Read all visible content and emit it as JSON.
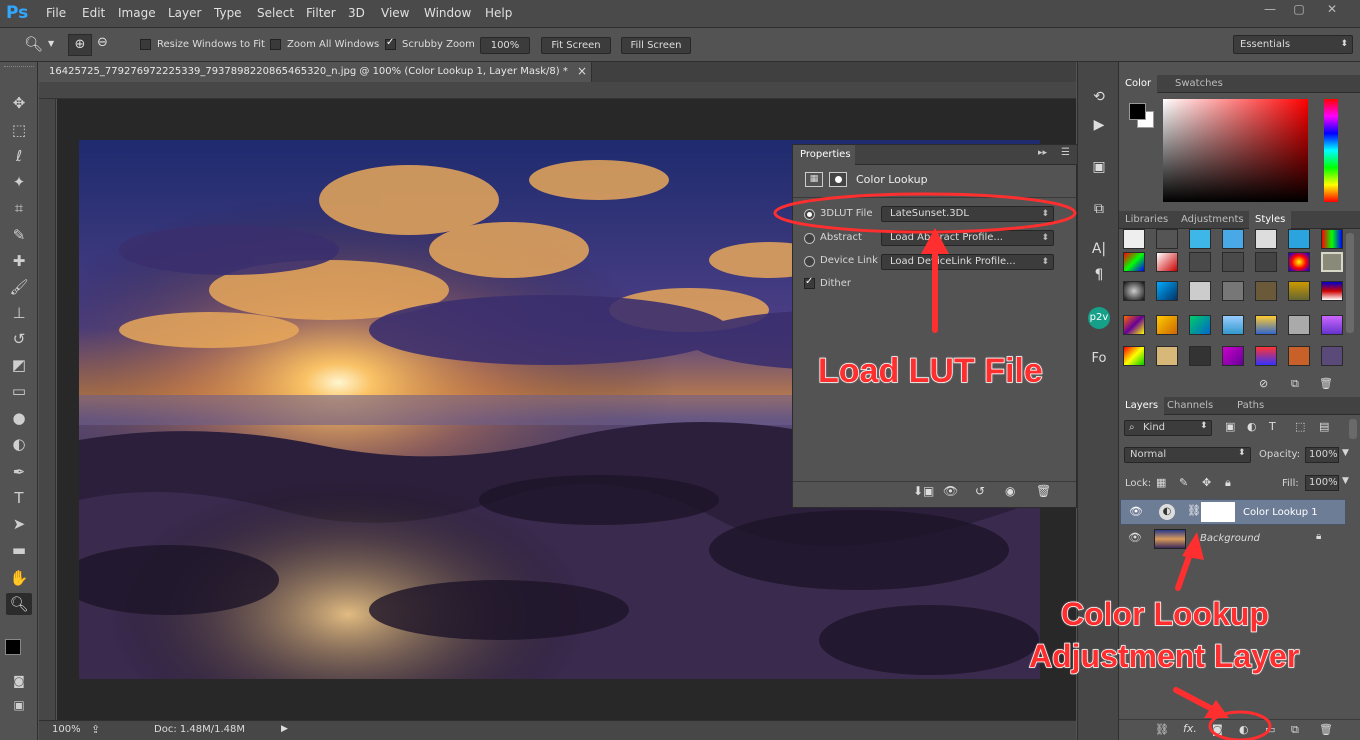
{
  "app": {
    "logo": "Ps",
    "menu": [
      "File",
      "Edit",
      "Image",
      "Layer",
      "Type",
      "Select",
      "Filter",
      "3D",
      "View",
      "Window",
      "Help"
    ],
    "window_controls": [
      "—",
      "▢",
      "✕"
    ]
  },
  "options_bar": {
    "resize_windows_label": "Resize Windows to Fit",
    "resize_windows_checked": false,
    "zoom_all_label": "Zoom All Windows",
    "zoom_all_checked": false,
    "scrubby_label": "Scrubby Zoom",
    "scrubby_checked": true,
    "zoom_100_label": "100%",
    "fit_screen_label": "Fit Screen",
    "fill_screen_label": "Fill Screen",
    "workspace": "Essentials"
  },
  "document": {
    "tab_title": "16425725_779276972225339_7937898220865465320_n.jpg @ 100% (Color Lookup 1, Layer Mask/8) *",
    "tab_close": "×",
    "zoom": "100%",
    "doc_info": "Doc: 1.48M/1.48M"
  },
  "properties": {
    "tab": "Properties",
    "title": "Color Lookup",
    "rows": [
      {
        "label": "3DLUT File",
        "value": "LateSunset.3DL",
        "selected": true
      },
      {
        "label": "Abstract",
        "value": "Load Abstract Profile...",
        "selected": false
      },
      {
        "label": "Device Link",
        "value": "Load DeviceLink Profile...",
        "selected": false
      }
    ],
    "dither_label": "Dither",
    "dither_checked": true
  },
  "color_panel": {
    "tabs": [
      "Color",
      "Swatches"
    ],
    "foreground": "#000000",
    "background": "#ffffff",
    "hue": "#ff0000"
  },
  "styles_panel": {
    "tabs": [
      "Libraries",
      "Adjustments",
      "Styles"
    ]
  },
  "layers_panel": {
    "tabs": [
      "Layers",
      "Channels",
      "Paths"
    ],
    "kind_label": "Kind",
    "blend_mode": "Normal",
    "opacity_label": "Opacity:",
    "opacity_value": "100%",
    "lock_label": "Lock:",
    "fill_label": "Fill:",
    "fill_value": "100%",
    "layers": [
      {
        "name": "Color Lookup 1",
        "selected": true
      },
      {
        "name": "Background",
        "selected": false
      }
    ]
  },
  "annotations": {
    "load_lut": "Load LUT File",
    "color_lookup_line1": "Color Lookup",
    "color_lookup_line2": "Adjustment Layer",
    "color": "#ff2f2f"
  },
  "dock": {
    "p2v": "p2v",
    "fo": "Fo"
  }
}
